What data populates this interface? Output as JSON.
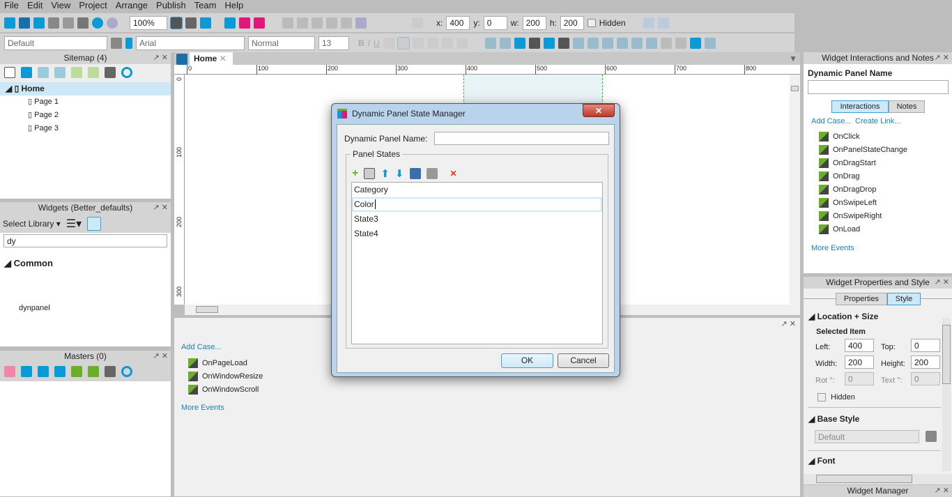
{
  "menu": [
    "File",
    "Edit",
    "View",
    "Project",
    "Arrange",
    "Publish",
    "Team",
    "Help"
  ],
  "toolbar": {
    "zoom": "100%",
    "x_label": "x:",
    "x": "400",
    "y_label": "y:",
    "y": "0",
    "w_label": "w:",
    "w": "200",
    "h_label": "h:",
    "h": "200",
    "hidden_label": "Hidden",
    "style": "Default",
    "font": "Arial",
    "weight": "Normal",
    "size": "13"
  },
  "sitemap": {
    "title": "Sitemap (4)",
    "root": "Home",
    "pages": [
      "Page 1",
      "Page 2",
      "Page 3"
    ]
  },
  "widgets": {
    "title": "Widgets (Better_defaults)",
    "select_library": "Select Library",
    "search": "dy",
    "group": "Common",
    "item": "dynpanel"
  },
  "masters": {
    "title": "Masters (0)"
  },
  "canvas": {
    "tab": "Home",
    "ruler_x": [
      "0",
      "100",
      "200",
      "300",
      "400",
      "500",
      "600",
      "700",
      "800"
    ],
    "ruler_y": [
      "0",
      "100",
      "200",
      "300"
    ]
  },
  "page_interactions": {
    "add_case": "Add Case...",
    "events": [
      "OnPageLoad",
      "OnWindowResize",
      "OnWindowScroll"
    ],
    "more": "More Events"
  },
  "right": {
    "title": "Widget Interactions and Notes",
    "name_label": "Dynamic Panel Name",
    "name_value": "",
    "tabs": [
      "Interactions",
      "Notes"
    ],
    "add_case": "Add Case...",
    "create_link": "Create Link...",
    "events": [
      "OnClick",
      "OnPanelStateChange",
      "OnDragStart",
      "OnDrag",
      "OnDragDrop",
      "OnSwipeLeft",
      "OnSwipeRight",
      "OnLoad"
    ],
    "more": "More Events"
  },
  "props": {
    "title": "Widget Properties and Style",
    "tabs": [
      "Properties",
      "Style"
    ],
    "section_location": "Location + Size",
    "selected": "Selected Item",
    "left_label": "Left:",
    "left": "400",
    "top_label": "Top:",
    "top": "0",
    "width_label": "Width:",
    "width": "200",
    "height_label": "Height:",
    "height": "200",
    "rot_label": "Rot °:",
    "rot": "0",
    "text_label": "Text °:",
    "text": "0",
    "hidden": "Hidden",
    "section_base": "Base Style",
    "base_value": "Default",
    "section_font": "Font"
  },
  "widget_manager": {
    "title": "Widget Manager"
  },
  "dialog": {
    "title": "Dynamic Panel State Manager",
    "name_label": "Dynamic Panel Name:",
    "name_value": "",
    "group": "Panel States",
    "states": [
      "Category",
      "Color",
      "State3",
      "State4"
    ],
    "editing_index": 1,
    "ok": "OK",
    "cancel": "Cancel"
  },
  "colors": {
    "accent": "#0a9ad8",
    "selection": "#cde8f6",
    "green": "#6aae2a",
    "delete": "#e8321e"
  }
}
